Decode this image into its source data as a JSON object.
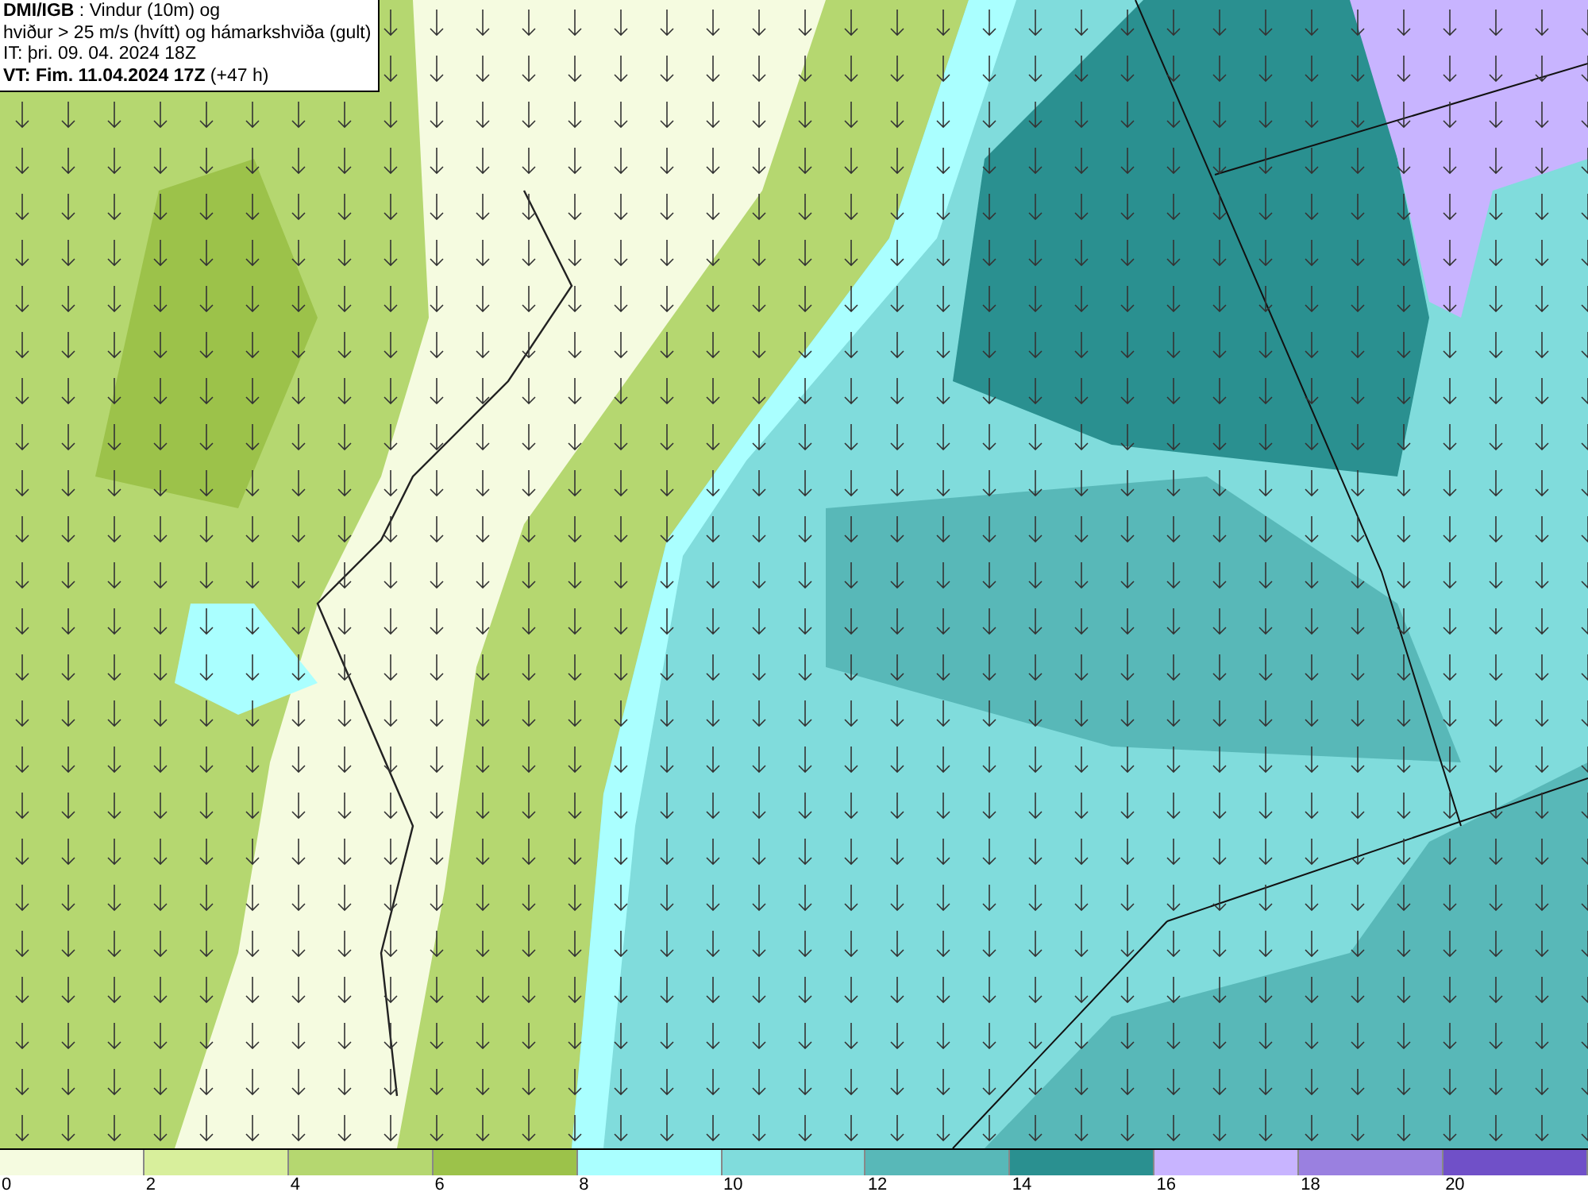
{
  "header": {
    "lines": [
      "**DMI/IGB** : Vindur (10m) og",
      "hviður > 25 m/s (hvítt) og hámarkshviða (gult)",
      "IT: þri. 09. 04. 2024 18Z",
      "**VT: Fim. 11.04.2024 17Z** (+47 h)"
    ]
  },
  "legend": [
    {
      "label": "0",
      "color": "#f5fbe0"
    },
    {
      "label": "2",
      "color": "#d8ef9c"
    },
    {
      "label": "4",
      "color": "#b5d770"
    },
    {
      "label": "6",
      "color": "#9cc24a"
    },
    {
      "label": "8",
      "color": "#aaffff"
    },
    {
      "label": "10",
      "color": "#80dcdc"
    },
    {
      "label": "12",
      "color": "#58b8b8"
    },
    {
      "label": "14",
      "color": "#2a9090"
    },
    {
      "label": "16",
      "color": "#c8b4ff"
    },
    {
      "label": "18",
      "color": "#9a80e0"
    },
    {
      "label": "20",
      "color": "#7050c8"
    }
  ]
}
